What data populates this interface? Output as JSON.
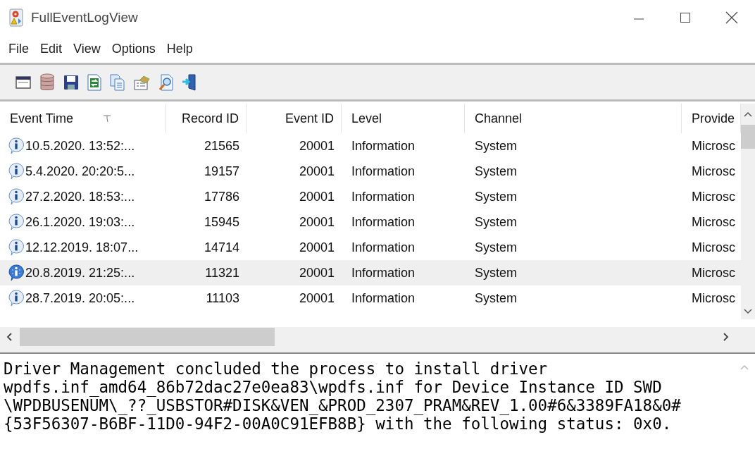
{
  "window": {
    "title": "FullEventLogView"
  },
  "menu": [
    {
      "label": "File"
    },
    {
      "label": "Edit"
    },
    {
      "label": "View"
    },
    {
      "label": "Options"
    },
    {
      "label": "Help"
    }
  ],
  "table": {
    "columns": [
      {
        "label": "Event Time",
        "sorted": true
      },
      {
        "label": "Record ID",
        "sorted": false
      },
      {
        "label": "Event ID",
        "sorted": false
      },
      {
        "label": "Level",
        "sorted": false
      },
      {
        "label": "Channel",
        "sorted": false
      },
      {
        "label": "Provide",
        "sorted": false
      }
    ],
    "rows": [
      {
        "selected": false,
        "cells": [
          "10.5.2020. 13:52:...",
          "21565",
          "20001",
          "Information",
          "System",
          "Microsc"
        ]
      },
      {
        "selected": false,
        "cells": [
          "5.4.2020. 20:20:5...",
          "19157",
          "20001",
          "Information",
          "System",
          "Microsc"
        ]
      },
      {
        "selected": false,
        "cells": [
          "27.2.2020. 18:53:...",
          "17786",
          "20001",
          "Information",
          "System",
          "Microsc"
        ]
      },
      {
        "selected": false,
        "cells": [
          "26.1.2020. 19:03:...",
          "15945",
          "20001",
          "Information",
          "System",
          "Microsc"
        ]
      },
      {
        "selected": false,
        "cells": [
          "12.12.2019. 18:07...",
          "14714",
          "20001",
          "Information",
          "System",
          "Microsc"
        ]
      },
      {
        "selected": true,
        "cells": [
          "20.8.2019. 21:25:...",
          "11321",
          "20001",
          "Information",
          "System",
          "Microsc"
        ]
      },
      {
        "selected": false,
        "cells": [
          "28.7.2019. 20:05:...",
          "11103",
          "20001",
          "Information",
          "System",
          "Microsc"
        ]
      }
    ]
  },
  "details": {
    "lines": [
      "Driver Management concluded the process to install driver",
      "wpdfs.inf_amd64_86b72dac27e0ea83\\wpdfs.inf for Device Instance ID SWD",
      "\\WPDBUSENUM\\_??_USBSTOR#DISK&VEN_&PROD_2307_PRAM&REV_1.00#6&3389FA18&0#",
      "{53F56307-B6BF-11D0-94F2-00A0C91EFB8B} with the following status: 0x0."
    ]
  }
}
